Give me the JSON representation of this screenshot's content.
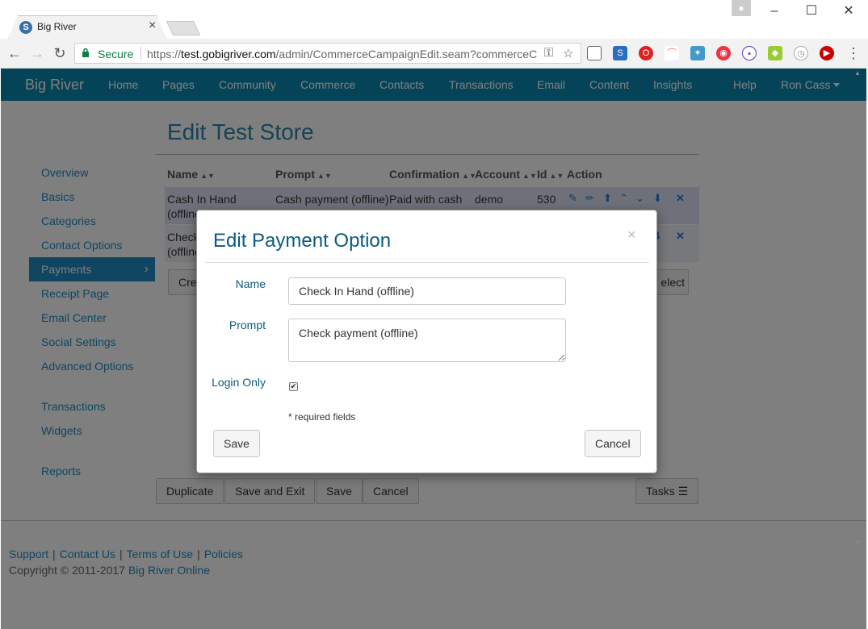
{
  "browser": {
    "tab_title": "Big River",
    "secure_label": "Secure",
    "url_prefix": "https://",
    "url_host": "test.gobigriver.com",
    "url_path": "/admin/CommerceCampaignEdit.seam?commerceC"
  },
  "navbar": {
    "brand": "Big River",
    "items": [
      "Home",
      "Pages",
      "Community",
      "Commerce",
      "Contacts",
      "Transactions",
      "Email",
      "Content",
      "Insights"
    ],
    "help": "Help",
    "user": "Ron Cass"
  },
  "page": {
    "title": "Edit Test Store"
  },
  "sidebar": {
    "items": [
      "Overview",
      "Basics",
      "Categories",
      "Contact Options",
      "Payments",
      "Receipt Page",
      "Email Center",
      "Social Settings",
      "Advanced Options",
      "Transactions",
      "Widgets",
      "Reports"
    ],
    "active": "Payments"
  },
  "table": {
    "headers": [
      "Name",
      "Prompt",
      "Confirmation",
      "Account",
      "Id",
      "Action"
    ],
    "rows": [
      {
        "name": "Cash In Hand",
        "name2": "(offline)",
        "prompt": "Cash payment (offline)",
        "confirmation": "Paid with cash",
        "account": "demo",
        "id": "530"
      },
      {
        "name": "Check",
        "name2": "(offline"
      }
    ],
    "create_button": "Cre",
    "select_button": "elect"
  },
  "bottom_actions": {
    "duplicate": "Duplicate",
    "save_and_exit": "Save and Exit",
    "save": "Save",
    "cancel": "Cancel",
    "tasks": "Tasks"
  },
  "footer": {
    "links": [
      "Support",
      "Contact Us",
      "Terms of Use",
      "Policies"
    ],
    "copyright_prefix": "Copyright © 2011-2017",
    "copyright_link": "Big River Online"
  },
  "modal": {
    "title": "Edit Payment Option",
    "name_label": "Name",
    "name_value": "Check In Hand (offline)",
    "prompt_label": "Prompt",
    "prompt_value": "Check payment (offline)",
    "login_label": "Login Only",
    "login_checked": true,
    "required_note": "* required fields",
    "save_label": "Save",
    "cancel_label": "Cancel"
  },
  "colors": {
    "navbar": "#0a88b0",
    "link": "#1e8ac2",
    "modal_title": "#0a5a82"
  }
}
